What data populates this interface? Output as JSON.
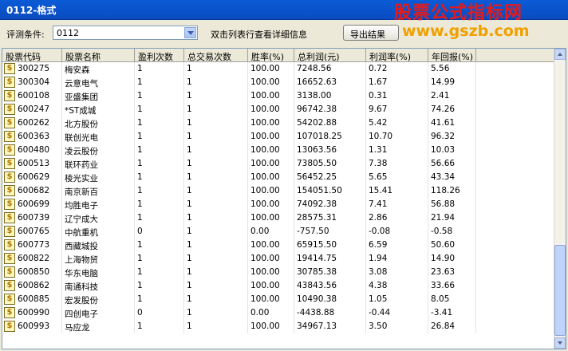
{
  "window": {
    "title": "0112-格式"
  },
  "watermark": {
    "line1": "股票公式指标网",
    "line2": "www.gszb.com"
  },
  "toolbar": {
    "condition_label": "评测条件:",
    "condition_value": "0112",
    "hint": "双击列表行查看详细信息",
    "export_label": "导出结果"
  },
  "table": {
    "headers": [
      "股票代码",
      "股票名称",
      "盈利次数",
      "总交易次数",
      "胜率(%)",
      "总利润(元)",
      "利润率(%)",
      "年回报(%)"
    ],
    "rows": [
      [
        "300275",
        "梅安森",
        "1",
        "1",
        "100.00",
        "7248.56",
        "0.72",
        "5.56"
      ],
      [
        "300304",
        "云意电气",
        "1",
        "1",
        "100.00",
        "16652.63",
        "1.67",
        "14.99"
      ],
      [
        "600108",
        "亚盛集团",
        "1",
        "1",
        "100.00",
        "3138.00",
        "0.31",
        "2.41"
      ],
      [
        "600247",
        "*ST成城",
        "1",
        "1",
        "100.00",
        "96742.38",
        "9.67",
        "74.26"
      ],
      [
        "600262",
        "北方股份",
        "1",
        "1",
        "100.00",
        "54202.88",
        "5.42",
        "41.61"
      ],
      [
        "600363",
        "联创光电",
        "1",
        "1",
        "100.00",
        "107018.25",
        "10.70",
        "96.32"
      ],
      [
        "600480",
        "凌云股份",
        "1",
        "1",
        "100.00",
        "13063.56",
        "1.31",
        "10.03"
      ],
      [
        "600513",
        "联环药业",
        "1",
        "1",
        "100.00",
        "73805.50",
        "7.38",
        "56.66"
      ],
      [
        "600629",
        "棱光实业",
        "1",
        "1",
        "100.00",
        "56452.25",
        "5.65",
        "43.34"
      ],
      [
        "600682",
        "南京新百",
        "1",
        "1",
        "100.00",
        "154051.50",
        "15.41",
        "118.26"
      ],
      [
        "600699",
        "均胜电子",
        "1",
        "1",
        "100.00",
        "74092.38",
        "7.41",
        "56.88"
      ],
      [
        "600739",
        "辽宁成大",
        "1",
        "1",
        "100.00",
        "28575.31",
        "2.86",
        "21.94"
      ],
      [
        "600765",
        "中航重机",
        "0",
        "1",
        "0.00",
        "-757.50",
        "-0.08",
        "-0.58"
      ],
      [
        "600773",
        "西藏城投",
        "1",
        "1",
        "100.00",
        "65915.50",
        "6.59",
        "50.60"
      ],
      [
        "600822",
        "上海物贸",
        "1",
        "1",
        "100.00",
        "19414.75",
        "1.94",
        "14.90"
      ],
      [
        "600850",
        "华东电脑",
        "1",
        "1",
        "100.00",
        "30785.38",
        "3.08",
        "23.63"
      ],
      [
        "600862",
        "南通科技",
        "1",
        "1",
        "100.00",
        "43843.56",
        "4.38",
        "33.66"
      ],
      [
        "600885",
        "宏发股份",
        "1",
        "1",
        "100.00",
        "10490.38",
        "1.05",
        "8.05"
      ],
      [
        "600990",
        "四创电子",
        "0",
        "1",
        "0.00",
        "-4438.88",
        "-0.44",
        "-3.41"
      ],
      [
        "600993",
        "马应龙",
        "1",
        "1",
        "100.00",
        "34967.13",
        "3.50",
        "26.84"
      ]
    ]
  },
  "colors": {
    "title_bar": "#0a50c8",
    "watermark_red": "#e51b1b",
    "watermark_orange": "#f0a000"
  },
  "icons": {
    "row_icon": "dollar-stock-icon"
  }
}
